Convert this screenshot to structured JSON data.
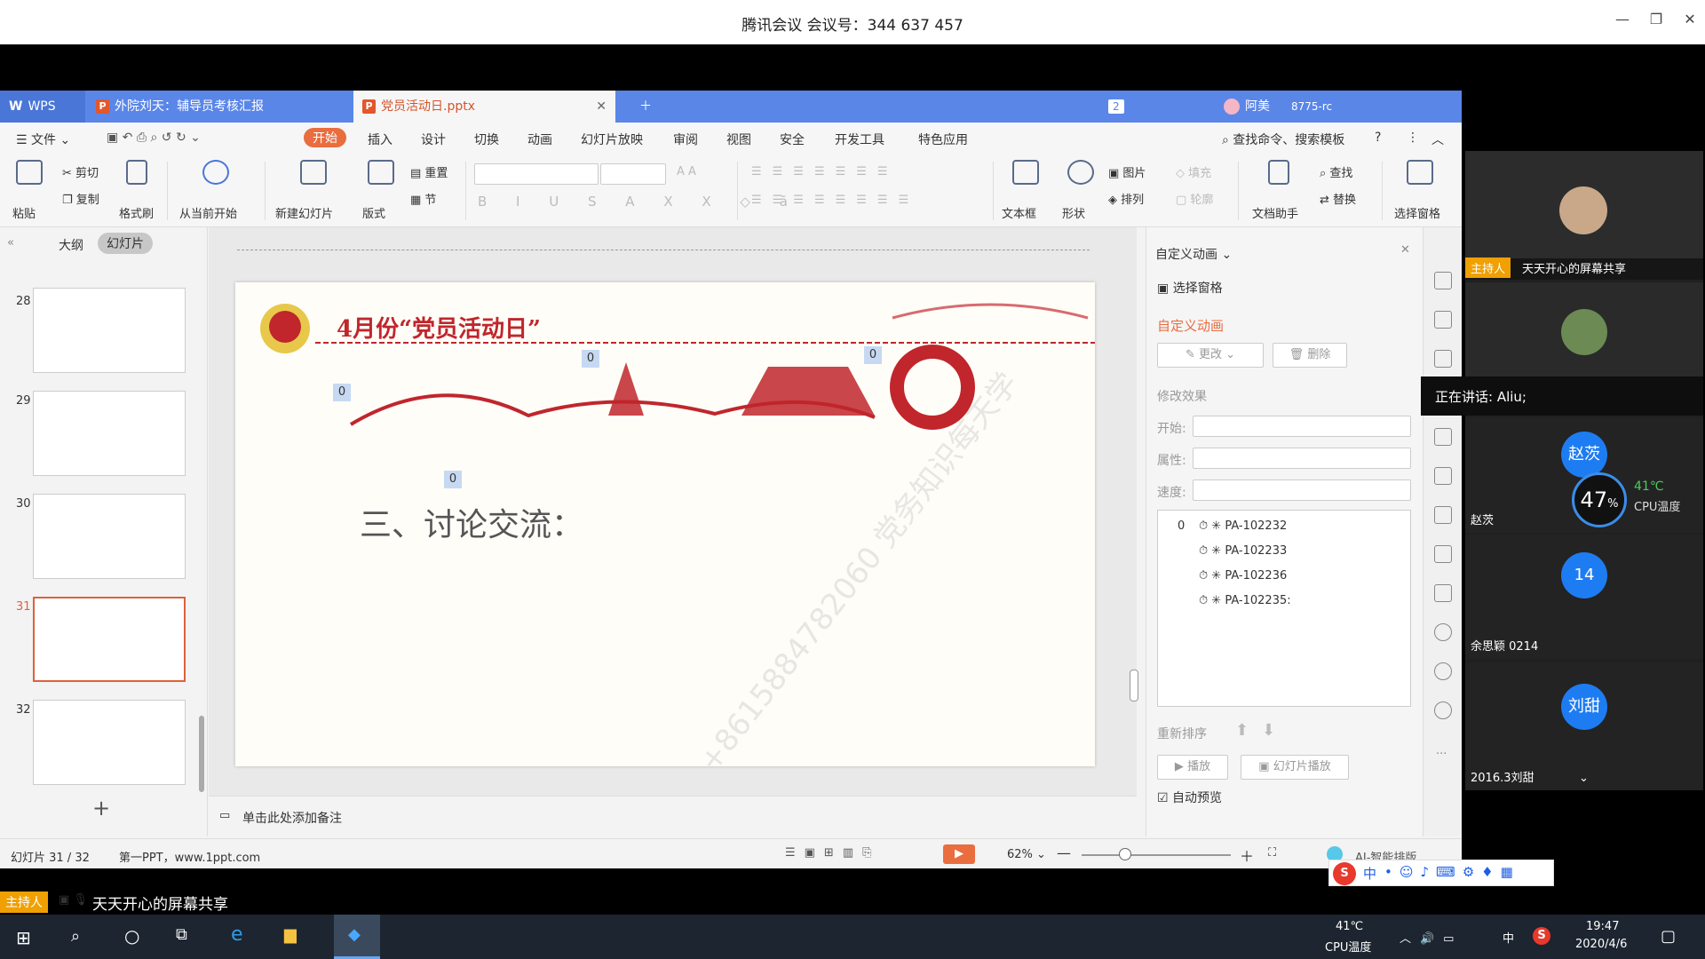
{
  "window": {
    "title": "腾讯会议 会议号：344 637 457"
  },
  "tabs": [
    {
      "label": "WPS"
    },
    {
      "label": "外院刘天：辅导员考核汇报"
    },
    {
      "label": "党员活动日.pptx"
    }
  ],
  "tabbar_right": {
    "badge": "2",
    "user": "阿美",
    "code": "8775-rc"
  },
  "menu": {
    "file": "文件",
    "items": [
      "开始",
      "插入",
      "设计",
      "切换",
      "动画",
      "幻灯片放映",
      "审阅",
      "视图",
      "安全",
      "开发工具",
      "特色应用"
    ],
    "search": "查找命令、搜索模板"
  },
  "ribbon": {
    "paste": "粘贴",
    "cut": "剪切",
    "copy": "复制",
    "format_painter": "格式刷",
    "from_current": "从当前开始",
    "new_slide": "新建幻灯片",
    "layout": "版式",
    "reset": "重置",
    "section": "节",
    "textbox": "文本框",
    "shape": "形状",
    "picture": "图片",
    "arrange": "排列",
    "fill": "填充",
    "outline": "轮廓",
    "doc_helper": "文档助手",
    "find": "查找",
    "replace": "替换",
    "select_pane": "选择窗格"
  },
  "leftpane": {
    "tab_outline": "大纲",
    "tab_slides": "幻灯片",
    "thumbs": [
      {
        "num": "28"
      },
      {
        "num": "29"
      },
      {
        "num": "30"
      },
      {
        "num": "31"
      },
      {
        "num": "32"
      }
    ],
    "add": "+"
  },
  "slide": {
    "title": "4月份“党员活动日”",
    "body": "三、讨论交流：",
    "tag": "0",
    "watermark": "+8615884782060 党务知识每天学"
  },
  "notes": {
    "placeholder": "单击此处添加备注"
  },
  "animpane": {
    "header": "自定义动画",
    "select_pane": "选择窗格",
    "section_title": "自定义动画",
    "change": "更改",
    "delete": "删除",
    "modify": "修改效果",
    "start": "开始:",
    "property": "属性:",
    "speed": "速度:",
    "list_index": "0",
    "items": [
      "PA-102232",
      "PA-102233",
      "PA-102236",
      "PA-102235:"
    ],
    "reorder": "重新排序",
    "play": "播放",
    "slideshow": "幻灯片播放",
    "autopreview": "自动预览"
  },
  "status": {
    "slide": "幻灯片 31 / 32",
    "template": "第一PPT，www.1ppt.com",
    "zoom": "62%",
    "ai": "AI-智能排版"
  },
  "meeting": {
    "host_badge": "主持人",
    "host_share": "天天开心的屏幕共享",
    "speaking": "正在讲话: Aliu;",
    "participants": [
      {
        "avatar": "赵茨",
        "name": "赵茨"
      },
      {
        "avatar": "14",
        "name": "余思颖 0214"
      },
      {
        "avatar": "刘甜",
        "name": "2016.3刘甜"
      }
    ],
    "cpu_pct": "47",
    "cpu_unit": "%",
    "cpu_temp": "41℃",
    "cpu_label": "CPU温度"
  },
  "bottom_share": {
    "badge": "主持人",
    "text": "天天开心的屏幕共享"
  },
  "ime": {
    "label": "中"
  },
  "taskbar": {
    "temp": "41℃",
    "temp_label": "CPU温度",
    "ime": "中",
    "time": "19:47",
    "date": "2020/4/6"
  }
}
